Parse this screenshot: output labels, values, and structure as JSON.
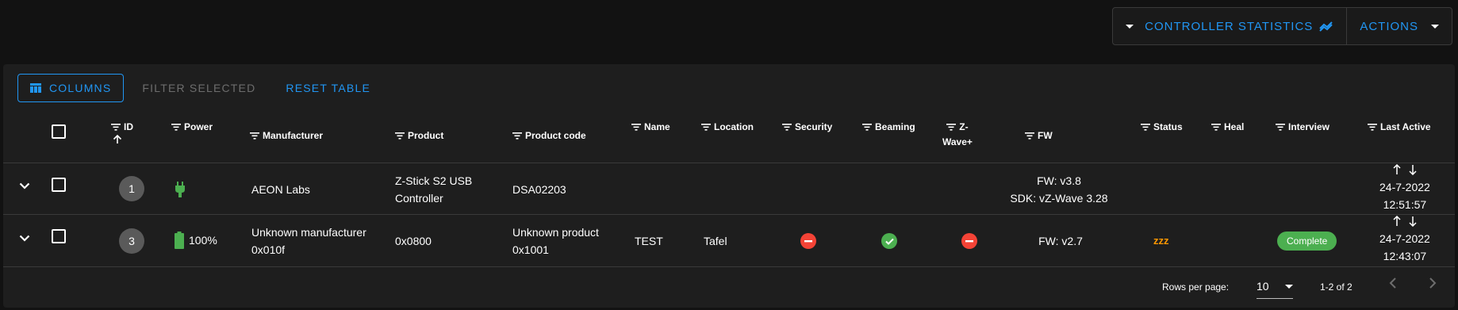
{
  "toolbar": {
    "controller_statistics_label": "CONTROLLER STATISTICS",
    "actions_label": "ACTIONS"
  },
  "table_actions": {
    "columns_label": "COLUMNS",
    "filter_selected_label": "FILTER SELECTED",
    "reset_table_label": "RESET TABLE"
  },
  "headers": {
    "id": "ID",
    "power": "Power",
    "manufacturer": "Manufacturer",
    "product": "Product",
    "product_code": "Product code",
    "name": "Name",
    "location": "Location",
    "security": "Security",
    "beaming": "Beaming",
    "zwave_plus_1": "Z-",
    "zwave_plus_2": "Wave+",
    "fw": "FW",
    "status": "Status",
    "heal": "Heal",
    "interview": "Interview",
    "last_active": "Last Active"
  },
  "rows": [
    {
      "id": "1",
      "power": "plug-icon",
      "manufacturer_1": "AEON Labs",
      "product_1": "Z-Stick S2 USB",
      "product_2": "Controller",
      "product_code": "DSA02203",
      "name": "",
      "location": "",
      "fw_1": "FW: v3.8",
      "fw_2": "SDK: vZ-Wave 3.28",
      "last_active_date": "24-7-2022",
      "last_active_time": "12:51:57"
    },
    {
      "id": "3",
      "power_level": "100%",
      "manufacturer_1": "Unknown manufacturer",
      "manufacturer_2": "0x010f",
      "product_1": "0x0800",
      "product_code_1": "Unknown product",
      "product_code_2": "0x1001",
      "name": "TEST",
      "location": "Tafel",
      "security": "minus-circle-icon",
      "beaming": "check-circle-icon",
      "zwave_plus": "minus-circle-icon",
      "fw_1": "FW: v2.7",
      "status": "sleep-icon",
      "status_text": "zzz",
      "interview": "Complete",
      "last_active_date": "24-7-2022",
      "last_active_time": "12:43:07"
    }
  ],
  "footer": {
    "rows_per_page_label": "Rows per page:",
    "rows_per_page_value": "10",
    "range_label": "1-2 of 2"
  },
  "colors": {
    "accent": "#2196f3",
    "success": "#4caf50",
    "error": "#f44336",
    "warning": "#ff9800"
  }
}
